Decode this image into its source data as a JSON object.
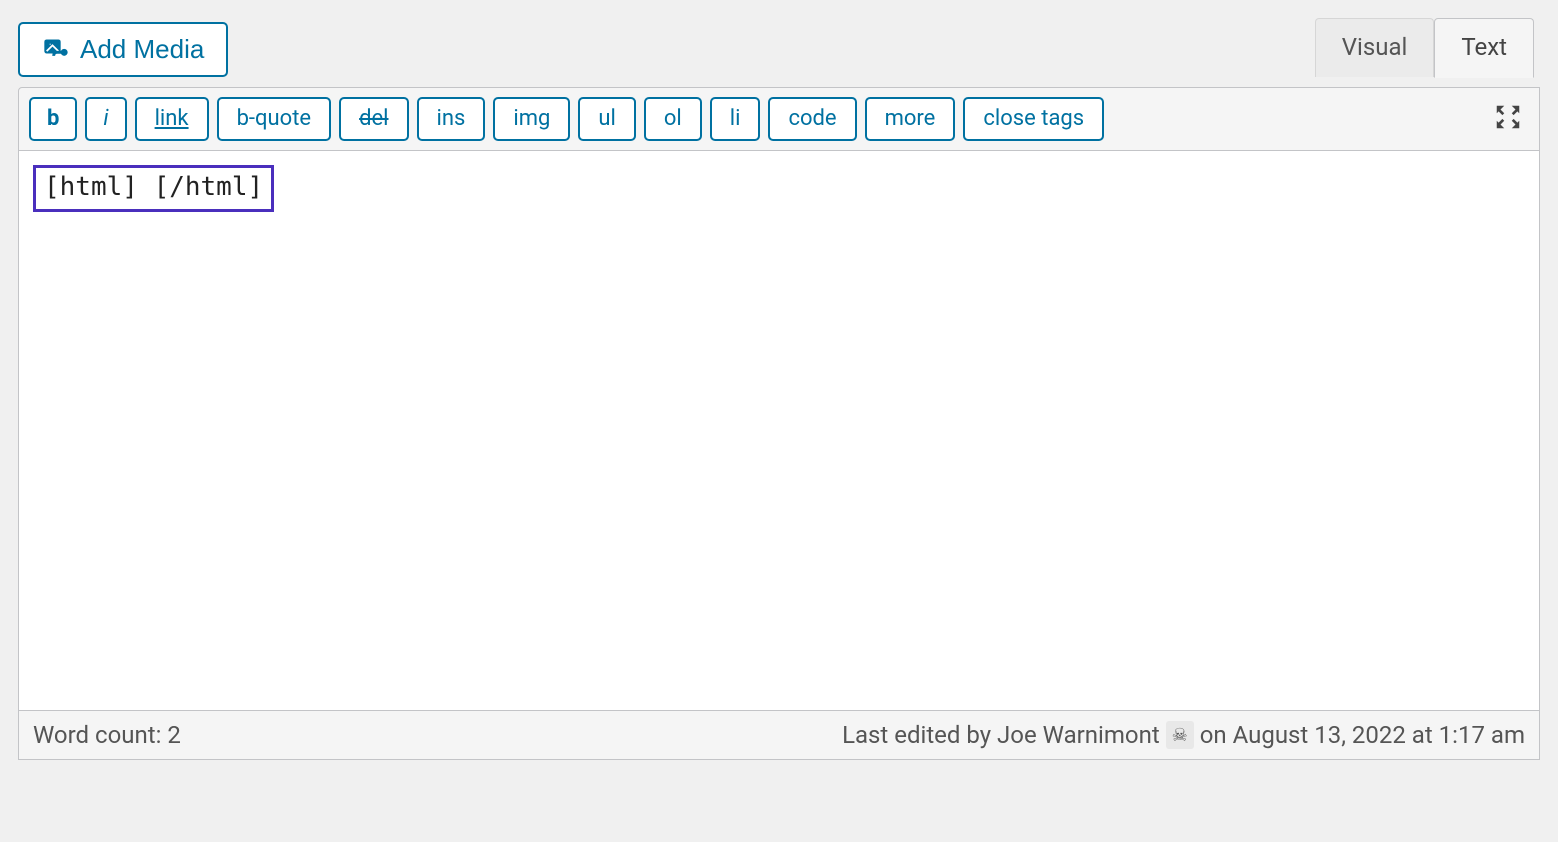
{
  "media_button": {
    "label": "Add Media"
  },
  "tabs": {
    "visual": "Visual",
    "text": "Text"
  },
  "quicktags": {
    "b": "b",
    "i": "i",
    "link": "link",
    "bquote": "b-quote",
    "del": "del",
    "ins": "ins",
    "img": "img",
    "ul": "ul",
    "ol": "ol",
    "li": "li",
    "code": "code",
    "more": "more",
    "close": "close tags"
  },
  "content": "[html] [/html]",
  "status": {
    "word_count_label": "Word count: 2",
    "last_edited_prefix": "Last edited by Joe Warnimont",
    "last_edited_suffix": "on August 13, 2022 at 1:17 am",
    "avatar_glyph": "☠"
  }
}
